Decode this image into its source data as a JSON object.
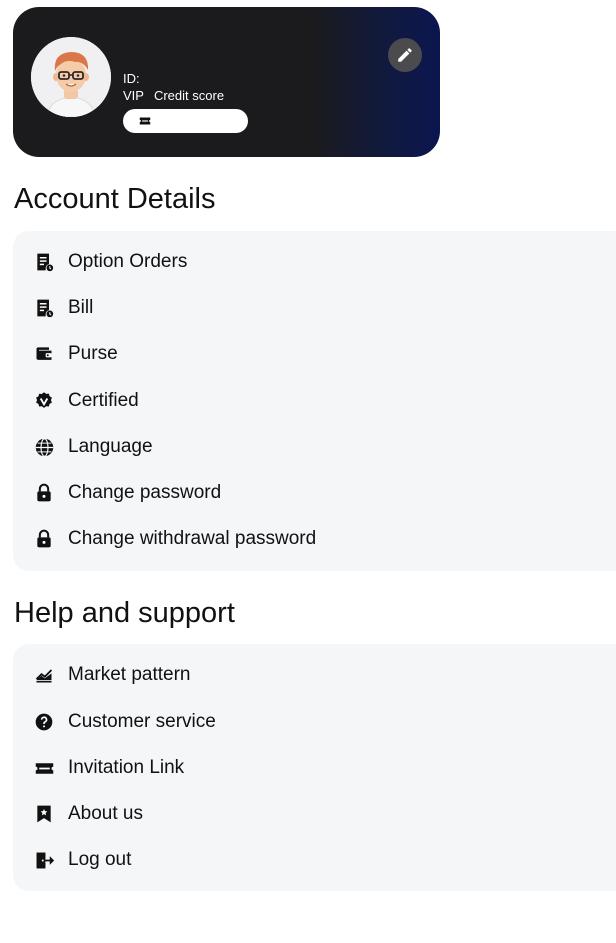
{
  "profile": {
    "id_label": "ID:",
    "vip_label": "VIP",
    "credit_label": "Credit score"
  },
  "account": {
    "title": "Account Details",
    "items": [
      {
        "label": "Option Orders",
        "icon": "receipt-icon"
      },
      {
        "label": "Bill",
        "icon": "receipt-icon"
      },
      {
        "label": "Purse",
        "icon": "wallet-icon"
      },
      {
        "label": "Certified",
        "icon": "verified-badge-icon"
      },
      {
        "label": "Language",
        "icon": "globe-icon"
      },
      {
        "label": "Change password",
        "icon": "lock-icon"
      },
      {
        "label": "Change withdrawal password",
        "icon": "lock-icon"
      }
    ]
  },
  "support": {
    "title": "Help and support",
    "items": [
      {
        "label": "Market pattern",
        "icon": "chart-icon"
      },
      {
        "label": "Customer service",
        "icon": "help-circle-icon"
      },
      {
        "label": "Invitation Link",
        "icon": "ticket-icon"
      },
      {
        "label": "About us",
        "icon": "bookmark-star-icon"
      },
      {
        "label": "Log out",
        "icon": "logout-icon"
      }
    ]
  },
  "colors": {
    "card_dark": "#1b1b1d",
    "card_blue": "#0b1650",
    "panel_bg": "#f5f6f8",
    "icon": "#111111"
  }
}
